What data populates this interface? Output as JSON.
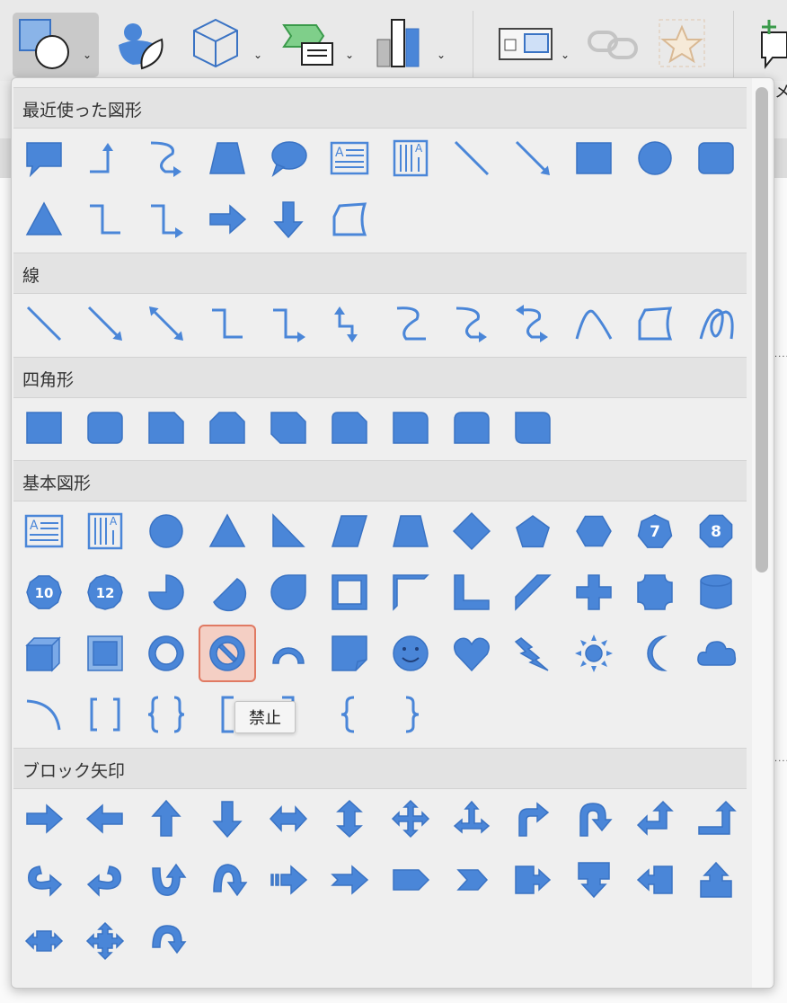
{
  "toolbar": {
    "items": [
      "shapes-icon",
      "icons-icon",
      "3d-models-icon",
      "smartart-icon",
      "chart-icon",
      "screenshot-icon",
      "link-icon",
      "action-icon",
      "comment-icon"
    ],
    "side_label": "メ"
  },
  "colors": {
    "shape_fill": "#4a86d8",
    "shape_stroke": "#3a73c4",
    "selected_bg": "#f4cfc4",
    "selected_border": "#e07a63"
  },
  "tooltip": "禁止",
  "sections": [
    {
      "title": "最近使った図形",
      "shapes": [
        "callout-rect",
        "elbow-arrow",
        "curved-arrow",
        "trapezoid",
        "oval-callout",
        "text-box",
        "vertical-text-box",
        "line",
        "arrow-line",
        "rectangle",
        "oval",
        "rounded-rectangle",
        "triangle",
        "elbow-connector",
        "elbow-arrow-connector",
        "right-arrow",
        "down-arrow",
        "freeform"
      ]
    },
    {
      "title": "線",
      "shapes": [
        "line",
        "arrow-line",
        "double-arrow-line",
        "elbow-connector",
        "elbow-arrow-connector",
        "elbow-double-arrow",
        "curved-connector",
        "curved-arrow-connector",
        "curved-double-arrow",
        "curve",
        "freeform",
        "scribble"
      ]
    },
    {
      "title": "四角形",
      "shapes": [
        "rectangle",
        "rounded-rectangle",
        "snip-single",
        "snip-same-side",
        "snip-diagonal",
        "snip-round",
        "round-single",
        "round-same-side",
        "round-diagonal"
      ]
    },
    {
      "title": "基本図形",
      "shapes": [
        "text-box",
        "vertical-text-box",
        "oval",
        "triangle",
        "right-triangle",
        "parallelogram",
        "trapezoid",
        "diamond",
        "pentagon",
        "hexagon",
        "heptagon",
        "octagon",
        "decagon",
        "dodecagon",
        "pie",
        "chord",
        "teardrop",
        "frame",
        "half-frame",
        "l-shape",
        "diagonal-stripe",
        "cross",
        "plaque",
        "can",
        "cube",
        "bevel",
        "donut",
        "no-symbol",
        "block-arc",
        "folded-corner",
        "smiley",
        "heart",
        "lightning",
        "sun",
        "moon",
        "cloud",
        "arc",
        "double-bracket",
        "double-brace",
        "left-bracket",
        "right-bracket",
        "left-brace",
        "right-brace"
      ],
      "numbers": {
        "heptagon": "7",
        "octagon": "8",
        "decagon": "10",
        "dodecagon": "12"
      }
    },
    {
      "title": "ブロック矢印",
      "shapes": [
        "right-arrow",
        "left-arrow",
        "up-arrow",
        "down-arrow",
        "left-right-arrow",
        "up-down-arrow",
        "quad-arrow",
        "left-right-up-arrow",
        "bent-arrow",
        "u-turn-arrow",
        "left-up-arrow",
        "bent-up-arrow",
        "curved-right-arrow",
        "curved-left-arrow",
        "curved-up-arrow",
        "curved-down-arrow",
        "striped-right-arrow",
        "notched-right-arrow",
        "pentagon-arrow",
        "chevron",
        "right-arrow-callout",
        "down-arrow-callout",
        "left-arrow-callout",
        "up-arrow-callout",
        "left-right-arrow-callout",
        "quad-arrow-callout",
        "circular-arrow"
      ]
    }
  ]
}
